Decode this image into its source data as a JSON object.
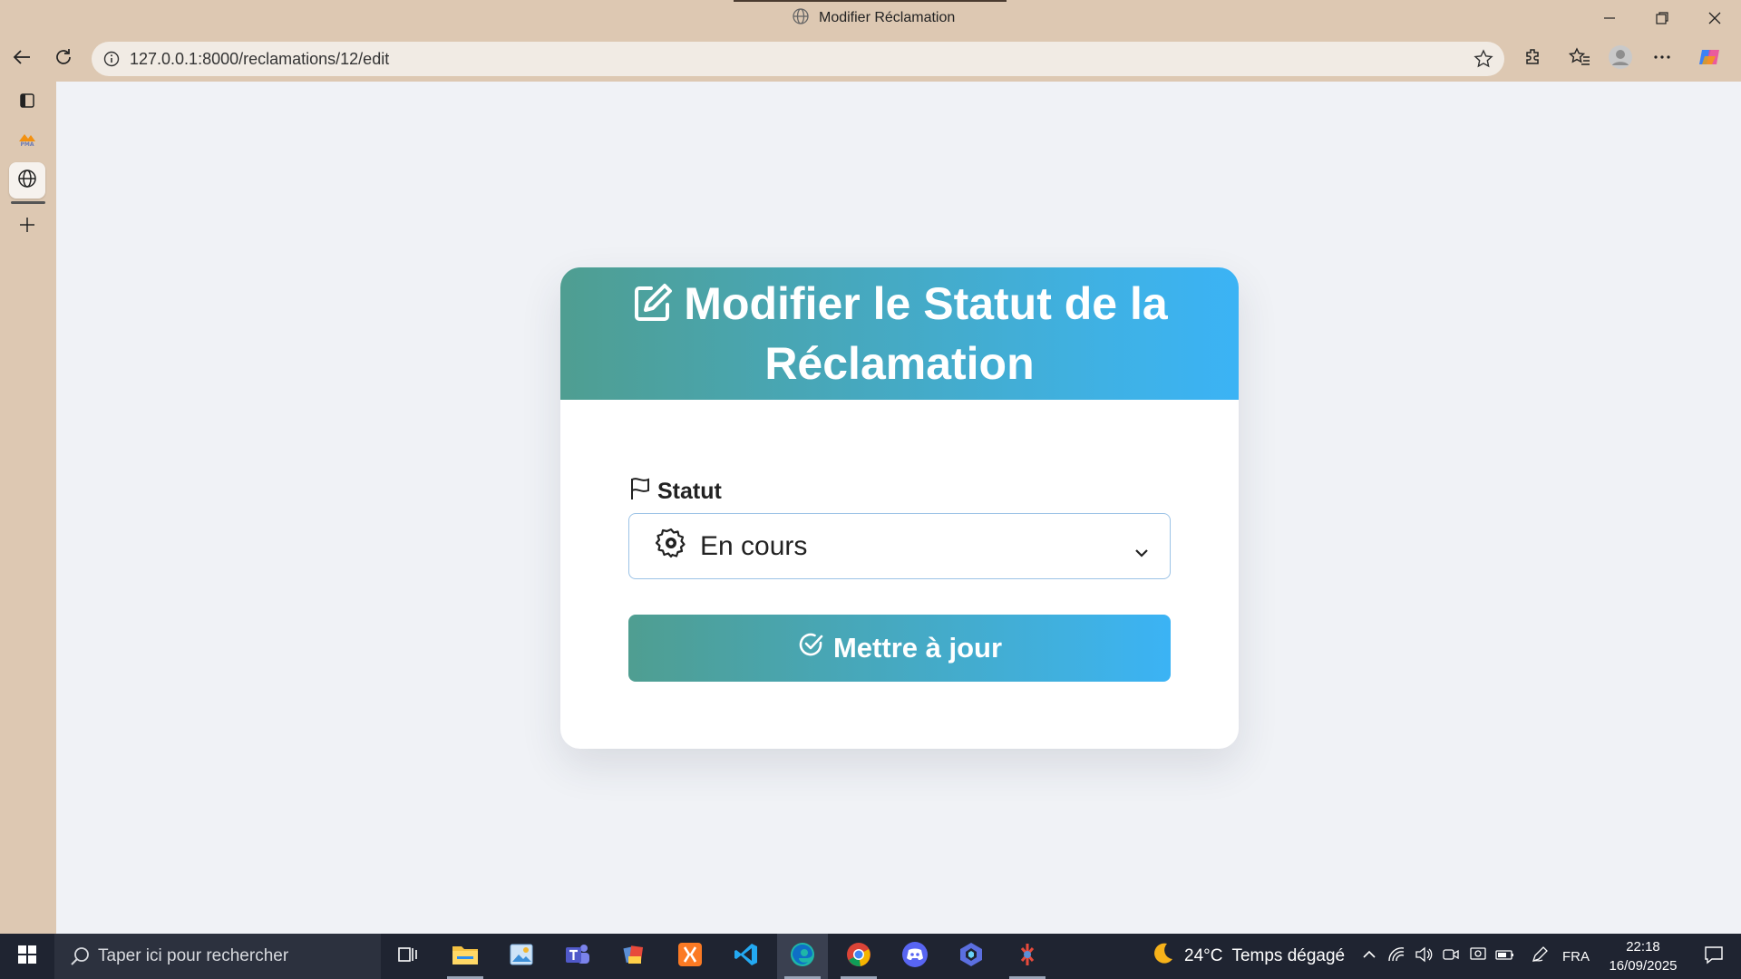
{
  "window": {
    "title": "Modifier Réclamation"
  },
  "browser": {
    "url": "127.0.0.1:8000/reclamations/12/edit",
    "icons": [
      "back-icon",
      "reload-icon",
      "site-info-icon",
      "favorite-star-icon",
      "extensions-icon",
      "favorites-icon",
      "profile-icon",
      "more-icon",
      "copilot-icon"
    ]
  },
  "sidebar": {
    "items": [
      {
        "name": "tab-actions-icon"
      },
      {
        "name": "pma-logo",
        "label": "PMA"
      },
      {
        "name": "globe-tab-icon"
      },
      {
        "name": "new-tab-plus-icon"
      }
    ]
  },
  "page": {
    "card_title": "Modifier le Statut de la Réclamation",
    "status_label": "Statut",
    "status_value": "En cours",
    "submit_label": "Mettre à jour",
    "colors": {
      "gradient_start": "#4f9e91",
      "gradient_end": "#3bb3f5",
      "page_bg": "#f0f2f6",
      "card_bg": "#ffffff"
    }
  },
  "taskbar": {
    "search_placeholder": "Taper ici pour rechercher",
    "weather_temp": "24°C",
    "weather_desc": "Temps dégagé",
    "language": "FRA",
    "time": "22:18",
    "date": "16/09/2025"
  }
}
